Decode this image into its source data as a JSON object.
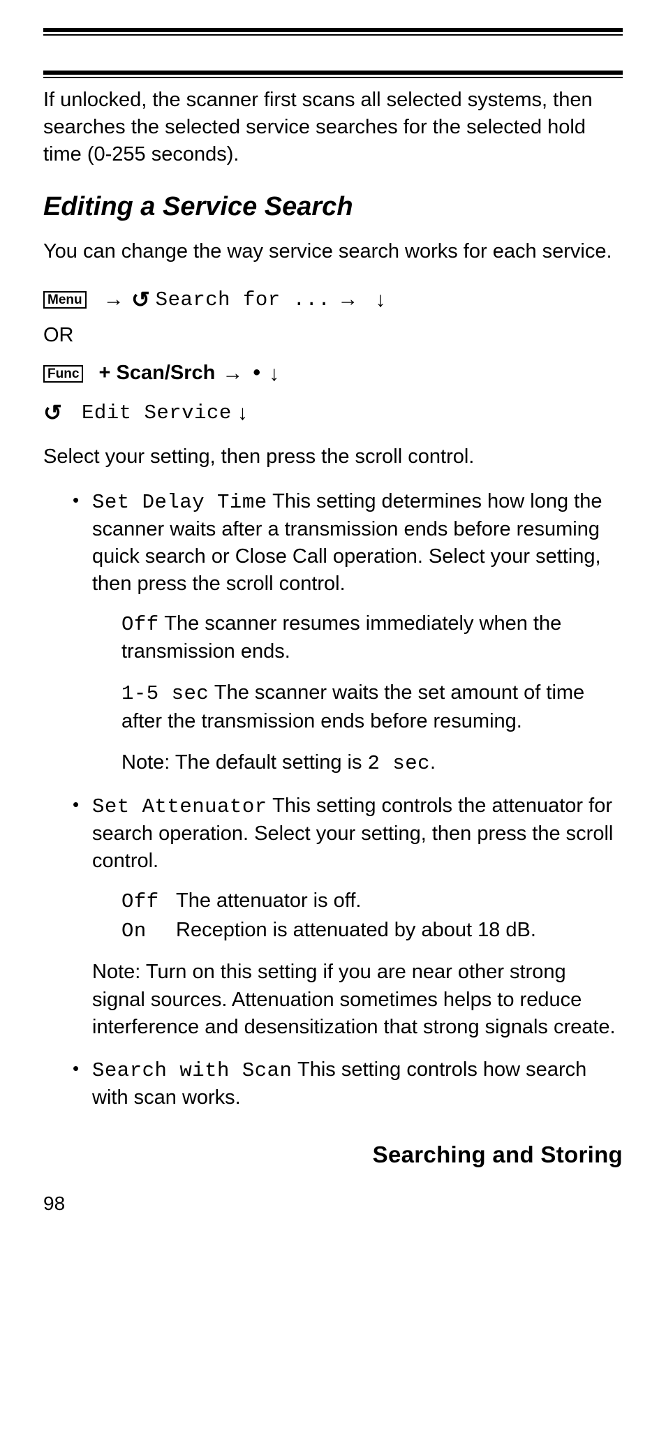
{
  "intro": "If unlocked, the scanner first scans all selected systems, then searches the selected service searches for the selected hold time (0-255 seconds).",
  "section_title": "Editing a Service Search",
  "section_intro": "You can change the way service search works for each service.",
  "buttons": {
    "menu": "Menu",
    "func": "Func"
  },
  "nav": {
    "search_for": "Search for ...",
    "or": "OR",
    "scan_srch": "+ Scan/Srch",
    "edit_service": "Edit Service"
  },
  "after_nav": "Select your setting, then press the scroll control.",
  "items": {
    "delay": {
      "label": "Set Delay Time",
      "desc": " This setting determines how long the scanner waits after a transmission ends before resuming quick search or Close Call operation. Select your setting, then press the scroll control.",
      "off_label": "Off",
      "off_desc": "  The scanner resumes immediately when the transmission ends.",
      "range_label": "1-5 sec",
      "range_desc": "  The scanner waits the set amount of time after the transmission ends before resuming.",
      "note_prefix": "Note: The default setting is ",
      "note_value": "2 sec",
      "note_suffix": "."
    },
    "atten": {
      "label": "Set Attenuator",
      "desc": " This setting controls the attenuator for search operation. Select your setting, then press the scroll control.",
      "off_label": "Off",
      "off_desc": "The attenuator is off.",
      "on_label": "On",
      "on_desc": "Reception is attenuated by about 18 dB.",
      "note": "Note: Turn on this setting if you are near other strong signal sources. Attenuation sometimes helps to reduce interference and desensitization that strong signals create."
    },
    "search_scan": {
      "label": "Search with Scan",
      "desc": " This setting controls how search with scan works."
    }
  },
  "footer_title": "Searching and Storing",
  "page_number": "98"
}
